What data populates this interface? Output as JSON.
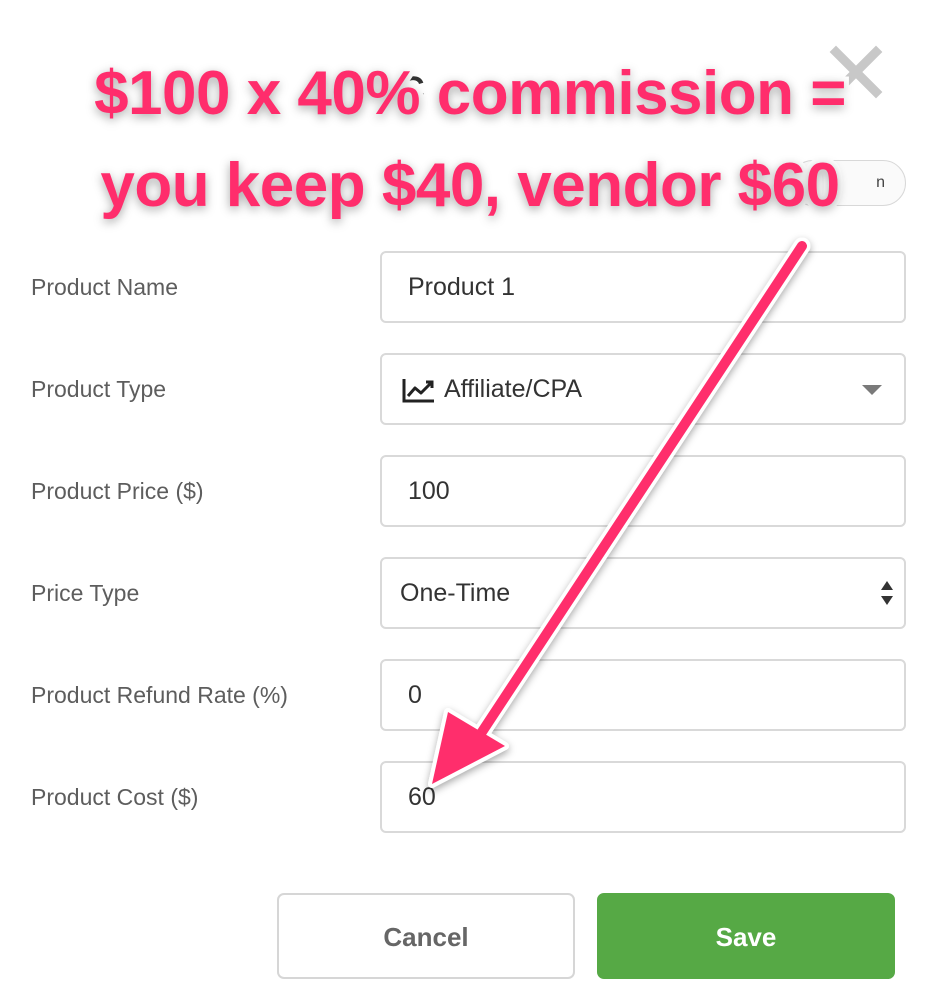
{
  "header": {
    "remnant_text": "C",
    "pill_text": "n"
  },
  "annotation": {
    "line1": "$100 x 40% commission =",
    "line2": "you keep $40, vendor $60",
    "color": "#ff2d6c"
  },
  "form": {
    "product_name": {
      "label": "Product Name",
      "value": "Product 1"
    },
    "product_type": {
      "label": "Product Type",
      "value": "Affiliate/CPA",
      "icon": "trend-line-icon"
    },
    "product_price": {
      "label": "Product Price ($)",
      "value": "100"
    },
    "price_type": {
      "label": "Price Type",
      "value": "One-Time"
    },
    "refund_rate": {
      "label": "Product Refund Rate (%)",
      "value": "0"
    },
    "product_cost": {
      "label": "Product Cost ($)",
      "value": "60"
    }
  },
  "buttons": {
    "cancel": "Cancel",
    "save": "Save",
    "save_color": "#56a945"
  }
}
